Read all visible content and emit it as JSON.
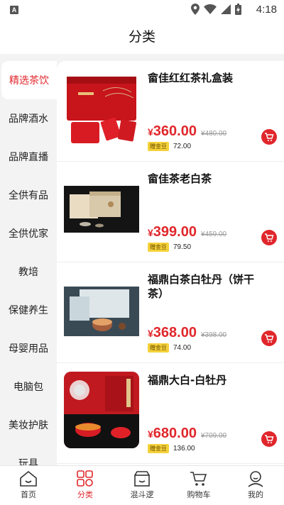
{
  "status_bar": {
    "time": "4:18",
    "app_badge": "A"
  },
  "header": {
    "title": "分类"
  },
  "sidebar": {
    "items": [
      {
        "label": "精选茶饮",
        "active": true
      },
      {
        "label": "品牌酒水"
      },
      {
        "label": "品牌直播"
      },
      {
        "label": "全供有品"
      },
      {
        "label": "全供优家"
      },
      {
        "label": "教培"
      },
      {
        "label": "保健养生"
      },
      {
        "label": "母婴用品"
      },
      {
        "label": "电脑包"
      },
      {
        "label": "美妆护肤"
      },
      {
        "label": "玩具"
      }
    ]
  },
  "products": [
    {
      "name": "畲佳红红茶礼盒装",
      "price": "360.00",
      "old_price": "¥480.00",
      "bean_label": "赠金豆",
      "bean_value": "72.00",
      "currency": "¥"
    },
    {
      "name": "畲佳茶老白茶",
      "price": "399.00",
      "old_price": "¥459.00",
      "bean_label": "赠金豆",
      "bean_value": "79.50",
      "currency": "¥"
    },
    {
      "name": "福鼎白茶白牡丹（饼干茶）",
      "price": "368.00",
      "old_price": "¥398.00",
      "bean_label": "赠金豆",
      "bean_value": "74.00",
      "currency": "¥"
    },
    {
      "name": "福鼎大白-白牡丹",
      "price": "680.00",
      "old_price": "¥709.00",
      "bean_label": "赠金豆",
      "bean_value": "136.00",
      "currency": "¥"
    }
  ],
  "tabbar": {
    "items": [
      {
        "label": "首页",
        "icon": "home-icon"
      },
      {
        "label": "分类",
        "icon": "category-icon",
        "active": true
      },
      {
        "label": "混斗逻",
        "icon": "shop-icon"
      },
      {
        "label": "购物车",
        "icon": "cart-icon"
      },
      {
        "label": "我的",
        "icon": "profile-icon"
      }
    ]
  },
  "colors": {
    "accent": "#e0272c",
    "bean_badge": "#f5d23a"
  }
}
